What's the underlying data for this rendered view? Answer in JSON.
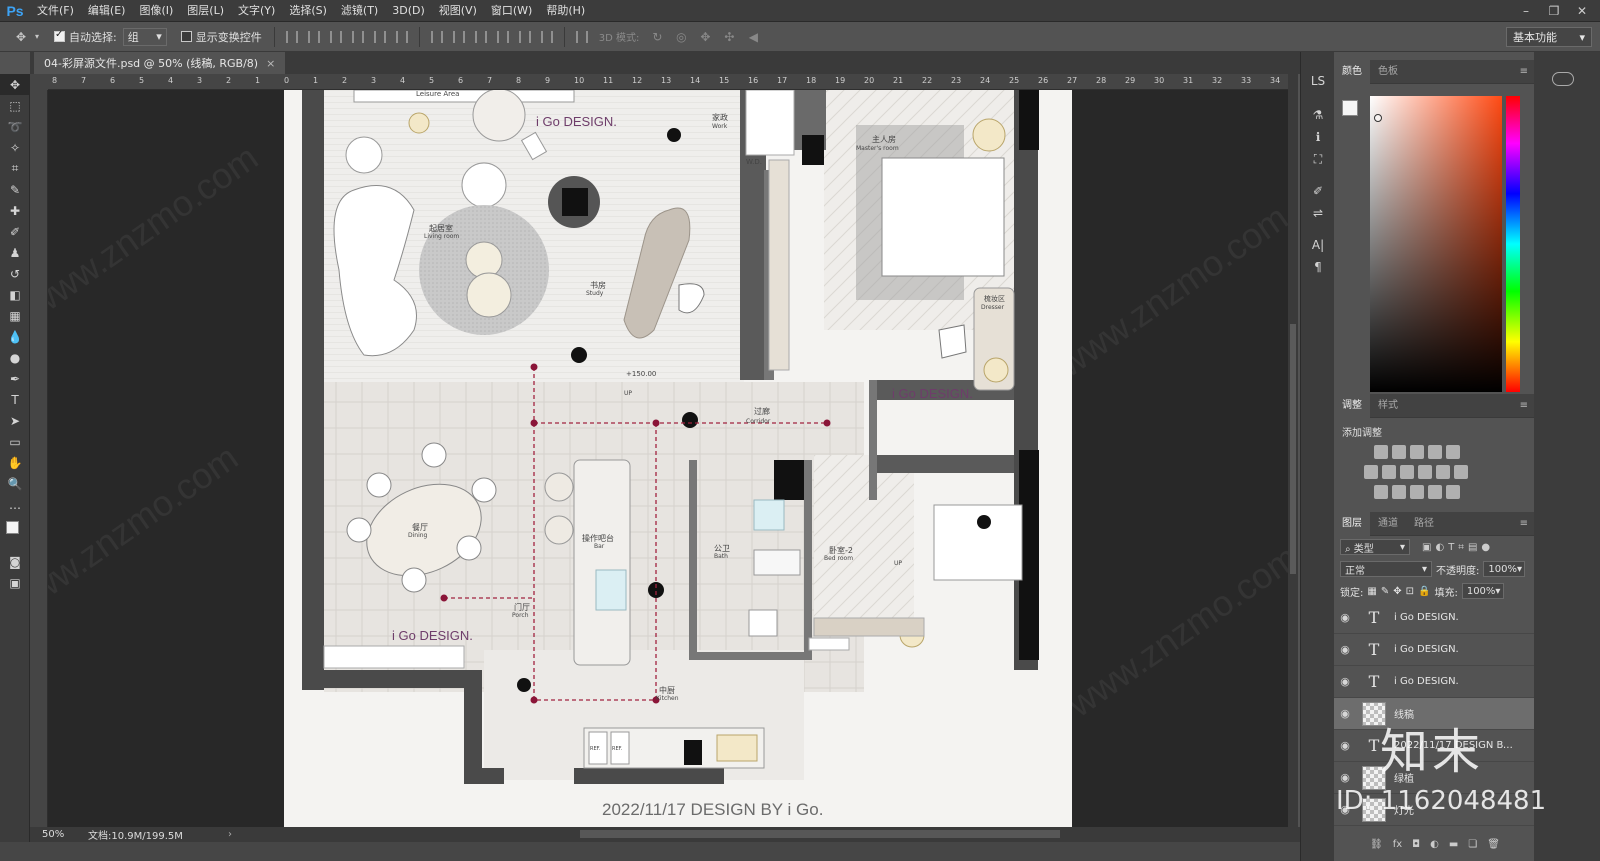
{
  "app": {
    "logo": "Ps"
  },
  "menu": [
    "文件(F)",
    "编辑(E)",
    "图像(I)",
    "图层(L)",
    "文字(Y)",
    "选择(S)",
    "滤镜(T)",
    "3D(D)",
    "视图(V)",
    "窗口(W)",
    "帮助(H)"
  ],
  "options": {
    "auto_select_label": "自动选择:",
    "auto_select_value": "组",
    "show_transform_label": "显示变换控件",
    "mode3d_label": "3D 模式:",
    "workspace": "基本功能"
  },
  "document": {
    "tab_title": "04-彩屏源文件.psd @ 50% (线稿, RGB/8)",
    "zoom": "50%",
    "doc_info": "文档:10.9M/199.5M"
  },
  "ruler_top": [
    "8",
    "7",
    "6",
    "5",
    "4",
    "3",
    "2",
    "1",
    "0",
    "1",
    "2",
    "3",
    "4",
    "5",
    "6",
    "7",
    "8",
    "9",
    "10",
    "11",
    "12",
    "13",
    "14",
    "15",
    "16",
    "17",
    "18",
    "19",
    "20",
    "21",
    "22",
    "23",
    "24",
    "25",
    "26",
    "27",
    "28",
    "29",
    "30",
    "31",
    "32",
    "33",
    "34"
  ],
  "plan": {
    "rooms": {
      "leisure": "Leisure Area",
      "work_cn": "家政",
      "work_en": "Work",
      "wd": "W.D.",
      "living_cn": "起居室",
      "living_en": "Living room",
      "study_cn": "书房",
      "study_en": "Study",
      "master_cn": "主人房",
      "master_en": "Master's room",
      "dresser_cn": "梳妆区",
      "dresser_en": "Dresser",
      "corridor_cn": "过廊",
      "corridor_en": "Corridor",
      "dining_cn": "餐厅",
      "dining_en": "Dining",
      "bar_cn": "操作吧台",
      "bar_en": "Bar",
      "bath_cn": "公卫",
      "bath_en": "Bath",
      "bed2_cn": "卧室-2",
      "bed2_en": "Bed room",
      "porch_cn": "门厅",
      "porch_en": "Porch",
      "kitchen_cn": "中厨",
      "kitchen_en": "Kitchen",
      "fridge1": "REF.",
      "fridge2": "REF."
    },
    "level": "+150.00",
    "up1": "UP",
    "up2": "UP",
    "brand": "i Go DESIGN.",
    "footer": "2022/11/17 DESIGN BY i Go."
  },
  "panels": {
    "color_tabs": [
      "颜色",
      "色板"
    ],
    "adjust_tabs": [
      "调整",
      "样式"
    ],
    "adjust_title": "添加调整",
    "layer_tabs": [
      "图层",
      "通道",
      "路径"
    ],
    "filter_kind": "类型",
    "blend_mode": "正常",
    "opacity_label": "不透明度:",
    "opacity_value": "100%",
    "lock_label": "锁定:",
    "fill_label": "填充:",
    "fill_value": "100%",
    "layers": [
      {
        "name": "i Go DESIGN.",
        "kind": "text"
      },
      {
        "name": "i Go DESIGN.",
        "kind": "text"
      },
      {
        "name": "i Go DESIGN.",
        "kind": "text"
      },
      {
        "name": "线稿",
        "kind": "image"
      },
      {
        "name": "2022/11/17 DESIGN BY i ...",
        "kind": "text"
      },
      {
        "name": "绿植",
        "kind": "image"
      },
      {
        "name": "灯光",
        "kind": "image"
      }
    ]
  },
  "overlay": {
    "logo": "知末",
    "id": "ID: 1162048481",
    "watermark": "www.znzmo.com"
  }
}
